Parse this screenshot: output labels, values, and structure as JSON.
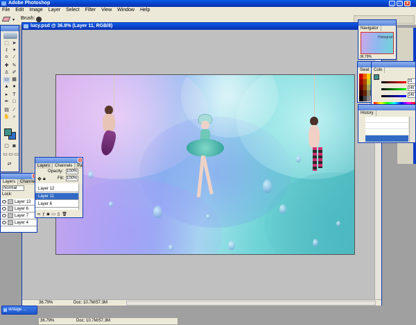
{
  "app": {
    "title": "Adobe Photoshop",
    "icon": "ps-feather-icon"
  },
  "menu": [
    "File",
    "Edit",
    "Image",
    "Layer",
    "Select",
    "Filter",
    "View",
    "Window",
    "Help"
  ],
  "options_bar": {
    "brush_label": "Brush:"
  },
  "document": {
    "title": "lucy.psd @ 36.8% (Layer 11, RGB/8)",
    "zoom": "36.79%",
    "doc_info": "Doc: 10.7M/57.3M",
    "artwork": "fantasy-clouds-girls-artwork"
  },
  "bottom_status": {
    "zoom": "36.79%",
    "doc_info": "Doc: 10.7M/57.3M"
  },
  "layers_panel": {
    "tabs": [
      "Layers",
      "Channels"
    ],
    "blend_mode": "Normal",
    "lock_label": "Lock:",
    "layers": [
      "Layer 13",
      "Layer 6",
      "Layer 7",
      "Layer 4"
    ]
  },
  "layers_panel2": {
    "tabs": [
      "Layers",
      "Channels",
      "Paths"
    ],
    "opacity_label": "Opacity:",
    "opacity_value": "100%",
    "fill_label": "Fill:",
    "fill_value": "100%",
    "layers": [
      "Layer 12",
      "Layer 11",
      "Layer 6"
    ],
    "selected": "Layer 11"
  },
  "navigator": {
    "tab": "Navigator",
    "subtab": "Histogram",
    "zoom": "36.79%"
  },
  "swatches": {
    "tab": "Swat"
  },
  "color": {
    "tab": "Colo",
    "values": [
      "31",
      "146",
      "146"
    ]
  },
  "history": {
    "tab": "History"
  },
  "taskbar": {
    "item": "vintage ..."
  },
  "colors": {
    "foreground": "#3f8f8a",
    "background": "#2f6fc8",
    "xp_blue": "#0a3dc4"
  }
}
